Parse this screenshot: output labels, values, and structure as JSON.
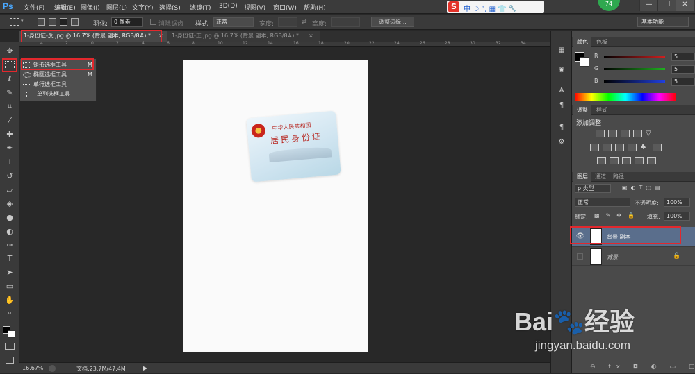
{
  "app": {
    "logo": "Ps"
  },
  "menu": [
    "文件(F)",
    "编辑(E)",
    "图像(I)",
    "图层(L)",
    "文字(Y)",
    "选择(S)",
    "滤镜(T)",
    "3D(D)",
    "视图(V)",
    "窗口(W)",
    "帮助(H)"
  ],
  "ime": {
    "logo": "S",
    "glyphs": "中 ☽ °, ▦ 👕 🔧"
  },
  "badge": "74",
  "window_controls": {
    "minimize": "—",
    "restore": "❐",
    "close": "✕"
  },
  "options": {
    "feather_label": "羽化:",
    "feather_value": "0 像素",
    "antialias_label": "消除锯齿",
    "style_label": "样式:",
    "style_value": "正常",
    "width_label": "宽度:",
    "height_label": "高度:",
    "refine_button": "调整边缘...",
    "workspace": "基本功能"
  },
  "tabs": [
    {
      "label": "1-身份证-反.jpg @ 16.7% (背景 副本, RGB/8#) *",
      "close": "×",
      "active": true
    },
    {
      "label": "1-身份证-正.jpg @ 16.7% (背景 副本, RGB/8#) *",
      "close": "×",
      "active": false
    }
  ],
  "ruler_ticks": [
    "4",
    "2",
    "0",
    "2",
    "4",
    "6",
    "8",
    "10",
    "12",
    "14",
    "16",
    "18",
    "20",
    "22",
    "24",
    "26",
    "28",
    "30",
    "32",
    "34"
  ],
  "flyout": [
    {
      "label": "矩形选框工具",
      "key": "M"
    },
    {
      "label": "椭圆选框工具",
      "key": "M"
    },
    {
      "label": "单行选框工具",
      "key": ""
    },
    {
      "label": "单列选框工具",
      "key": ""
    }
  ],
  "card": {
    "line1": "中华人民共和国",
    "line2": "居民身份证"
  },
  "status": {
    "zoom": "16.67%",
    "doc": "文档:23.7M/47.4M"
  },
  "color_panel": {
    "tabs": [
      "颜色",
      "色板"
    ],
    "channels": [
      {
        "label": "R",
        "value": "5",
        "color": "#d02020"
      },
      {
        "label": "G",
        "value": "5",
        "color": "#20b020"
      },
      {
        "label": "B",
        "value": "5",
        "color": "#2040e0"
      }
    ]
  },
  "adjust_panel": {
    "tabs": [
      "调整",
      "样式"
    ],
    "title": "添加调整"
  },
  "layers_panel": {
    "tabs": [
      "图层",
      "通道",
      "路径"
    ],
    "filter_label": "ρ 类型",
    "blend_mode": "正常",
    "opacity_label": "不透明度:",
    "opacity_value": "100%",
    "lock_label": "锁定:",
    "fill_label": "填充:",
    "fill_value": "100%",
    "layers": [
      {
        "name": "背景 副本",
        "selected": true,
        "visible": true
      },
      {
        "name": "背景",
        "selected": false,
        "visible": false,
        "locked": true
      }
    ],
    "footer_icons": "⊖ fx ◘ ◐ ▭ ▢ 🗑"
  },
  "watermark": {
    "logo": "Bai🐾经验",
    "url": "jingyan.baidu.com"
  },
  "colors": {
    "accent_red": "#e2282d",
    "ps_blue": "#4aa8ff",
    "selected_layer": "#5a6e8c"
  }
}
